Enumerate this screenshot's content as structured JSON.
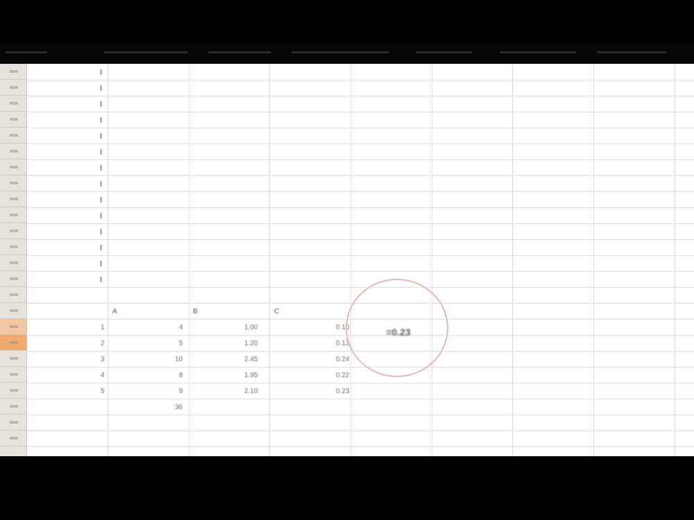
{
  "spreadsheet": {
    "row_count_visible": 24,
    "selected_row_index": 17,
    "column_a_values": [
      "",
      "",
      "",
      "",
      "",
      "",
      "",
      "",
      "",
      "",
      "",
      "",
      "",
      "",
      "",
      "",
      "",
      "",
      "",
      "",
      "",
      "",
      "",
      ""
    ],
    "block": {
      "header": {
        "col_a": "A",
        "col_b": "B",
        "col_c": "C"
      },
      "rows": [
        {
          "a": "1",
          "b": "4",
          "c": "1.00",
          "d": "0.10"
        },
        {
          "a": "2",
          "b": "5",
          "c": "1.20",
          "d": "0.13"
        },
        {
          "a": "3",
          "b": "10",
          "c": "2.45",
          "d": "0.24"
        },
        {
          "a": "4",
          "b": "8",
          "c": "1.95",
          "d": "0.22"
        },
        {
          "a": "5",
          "b": "9",
          "c": "2.10",
          "d": "0.23"
        },
        {
          "a": "",
          "b": "36",
          "c": "",
          "d": ""
        }
      ]
    },
    "highlighted_value": "=0.23"
  },
  "colors": {
    "background": "#000000",
    "sheet": "#ffffff",
    "row_header": "#e6e2dc",
    "selected_row_header": "#f0a96f",
    "highlight_circle": "#e6b8b8"
  },
  "icons": {
    "cursor": "mouse-pointer-icon"
  }
}
